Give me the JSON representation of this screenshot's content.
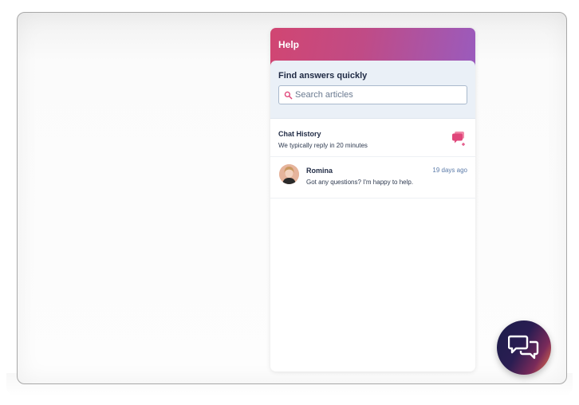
{
  "widget": {
    "title": "Help",
    "search": {
      "heading": "Find answers quickly",
      "placeholder": "Search articles"
    },
    "history": {
      "title": "Chat History",
      "subtitle": "We typically reply in 20 minutes"
    },
    "conversations": [
      {
        "name": "Romina",
        "time": "19 days ago",
        "message": "Got any questions? I'm happy to help."
      }
    ]
  },
  "colors": {
    "header_start": "#d14672",
    "header_end": "#9a5bbd",
    "accent_pink": "#e0467a",
    "search_panel_bg": "#eaf0f7",
    "launcher_start": "#1c1d4a",
    "launcher_end": "#f07a45"
  },
  "icons": {
    "search": "search-icon",
    "new_chat": "new-chat-icon",
    "launcher": "chat-bubbles-icon"
  }
}
